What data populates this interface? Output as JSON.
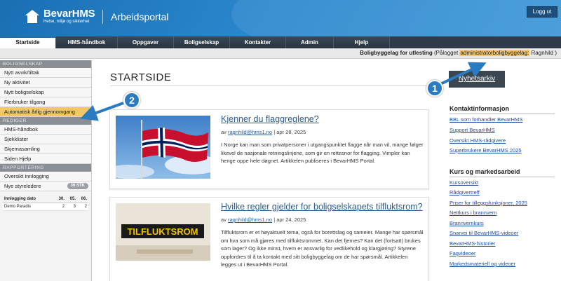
{
  "header": {
    "brand_name": "BevarHMS",
    "brand_tagline": "Helse, miljø og sikkerhet",
    "portal_title": "Arbeidsportal",
    "logout_label": "Logg ut"
  },
  "nav": {
    "tabs": [
      {
        "label": "Startside",
        "active": true
      },
      {
        "label": "HMS-håndbok"
      },
      {
        "label": "Oppgaver"
      },
      {
        "label": "Boligselskap"
      },
      {
        "label": "Kontakter"
      },
      {
        "label": "Admin"
      },
      {
        "label": "Hjelp"
      }
    ]
  },
  "orgbar": {
    "org_name": "Boligbyggelag for utlesting",
    "logged_in_prefix": "(Pålogget",
    "role": "administratorboligbyggelag:",
    "user": "Ragnhild )"
  },
  "sidebar": {
    "sections": [
      {
        "heading": "BOLIGSELSKAP",
        "items": [
          "Nytt avvik/tiltak",
          "Ny aktivitet",
          "Nytt boligselskap",
          "Flerbruker tilgang",
          "Automatisk årlig gjennomgang"
        ]
      },
      {
        "heading": "REDIGER",
        "items": [
          "HMS-håndbok",
          "Sjekklister",
          "Skjemasamling",
          "Siden Hjelp"
        ]
      },
      {
        "heading": "RAPPORTERING",
        "items": [
          "Oversikt innlogging",
          "Nye styreledere"
        ]
      }
    ],
    "new_leaders_badge": "36 STK",
    "login_table": {
      "headers": [
        "Innlogging dato",
        "30.",
        "05.",
        "06."
      ],
      "rows": [
        [
          "Demo Paradis",
          "2",
          "3",
          "2"
        ]
      ]
    }
  },
  "main": {
    "title": "STARTSIDE",
    "articles": [
      {
        "title": "Kjenner du flaggreglene?",
        "by": "av",
        "author": "ragnhild@hms1.no",
        "date": "| apr 28, 2025",
        "text": "I Norge kan man som privatpersoner i utgangspunktet flagge når man vil, mange følger likevel de nasjonale retningslinjene, som gir en rettesnor for flagging. Vimpler kan henge oppe hele døgnet. Artikkelen publiseres i BevarHMS Portal."
      },
      {
        "title": "Hvilke regler gjelder for boligselskapets tilfluktsrom?",
        "by": "av",
        "author": "ragnhild@hms1.no",
        "date": "| apr 24, 2025",
        "text": "Tilfluktsrom er et høyaktuelt tema, også for borettslag og sameier. Mange har spørsmål om hva som må gjøres med tilfluktsrommet. Kan det fjernes? Kan det (fortsatt) brukes som lager? Og ikke minst, hvem er ansvarlig for vedlikehold og klargjøring? Styrene oppfordres til å ta kontakt med sitt boligbyggelag om de har spørsmål. Artikkelen legges ut i BevarHMS Portal.",
        "image_sign": "TILFLUKTSROM"
      }
    ]
  },
  "right": {
    "archive_label": "Nyhetsarkiv",
    "contact_heading": "Kontaktinformasjon",
    "contact_links": [
      "BBL som forhandler BevarHMS",
      "Support BevarHMS",
      "Oversikt HMS-rådgivere",
      "Superbrukere BevarHMS 2025"
    ],
    "courses_heading": "Kurs og markedsarbeid",
    "course_links": [
      "Kursoversikt",
      "Rådgivertreff",
      "Priser for tilleggsfunksjoner, 2025",
      "Nettkurs i brannvern",
      "Brannvernkurs",
      "Snarvei til BevarHMS-videoer",
      "BevarHMS-historier",
      "Fagvideoer",
      "Markedsmateriell og videoer"
    ]
  },
  "callouts": [
    "1",
    "2"
  ],
  "colors": {
    "header_blue": "#2a86cc",
    "nav_dark": "#2f3b48",
    "highlight": "#f2c867",
    "link": "#2b5c8c",
    "callout": "#2a7bc0"
  }
}
